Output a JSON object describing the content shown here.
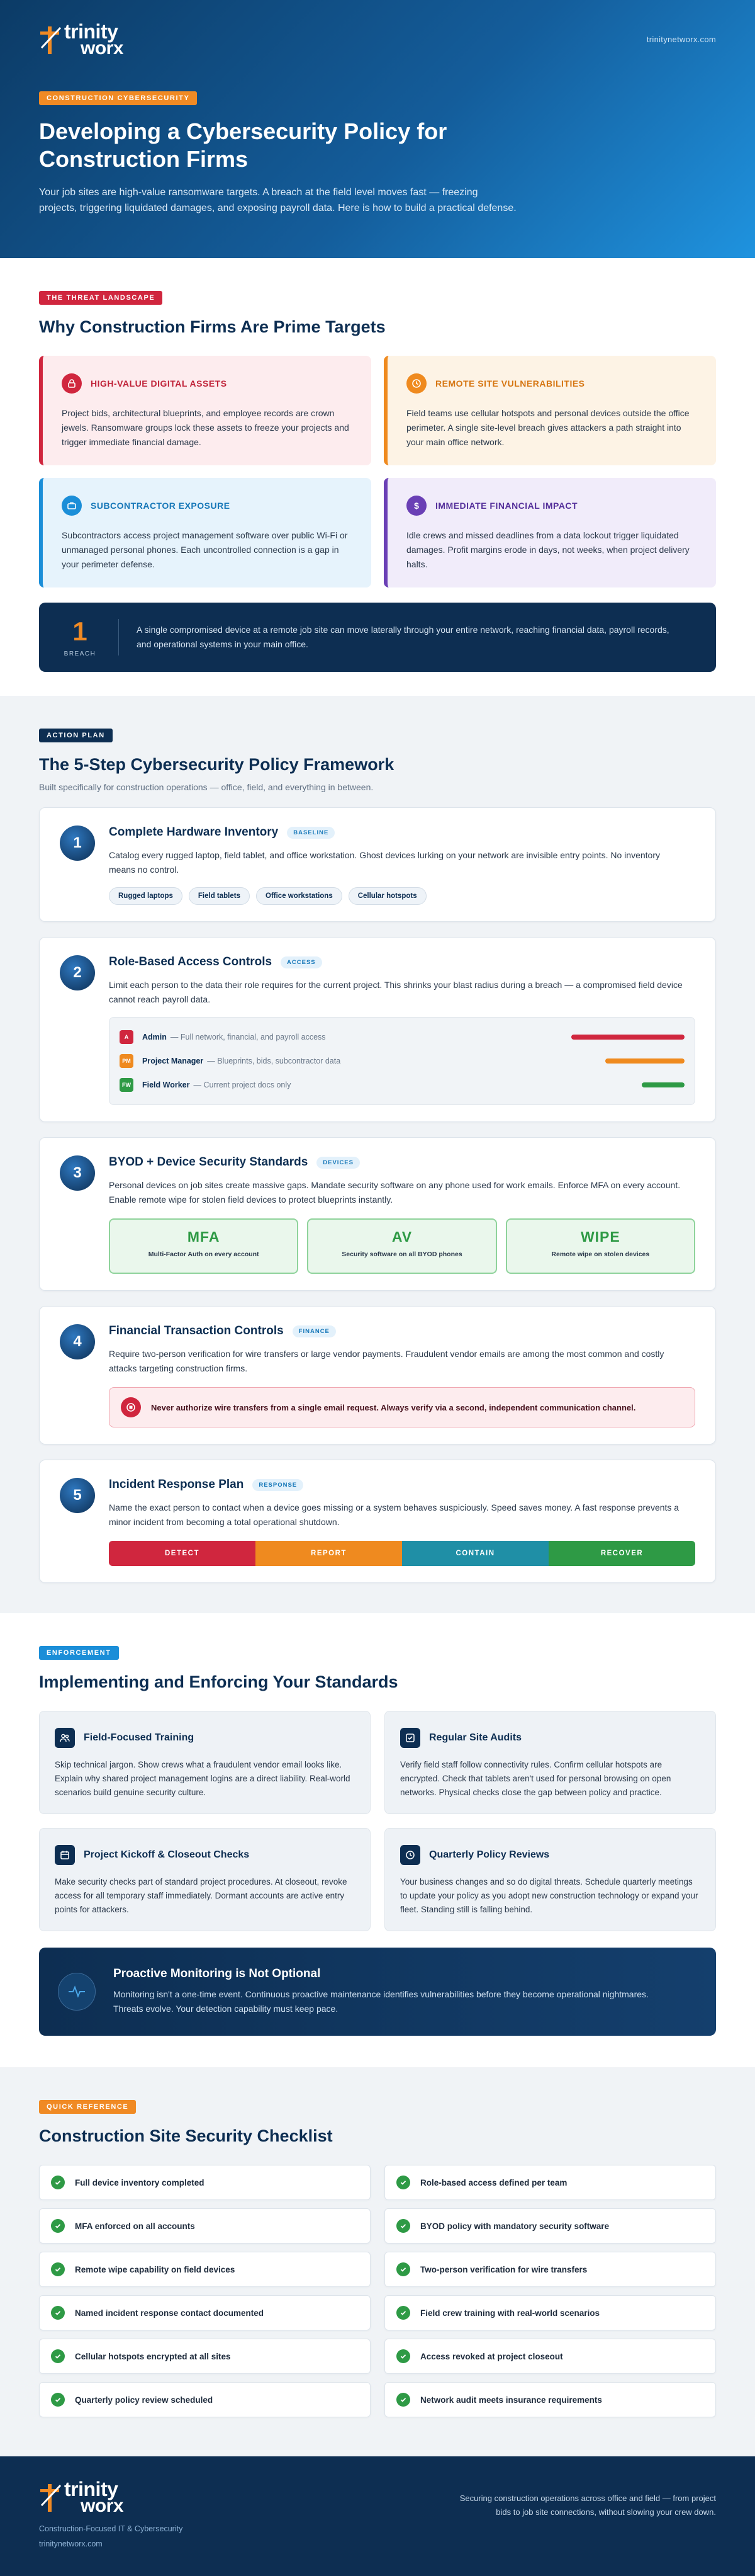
{
  "brand": {
    "logo_line1": "trinity",
    "logo_line2": "worx",
    "url": "trinitynetworx.com"
  },
  "hero": {
    "tag": "Construction Cybersecurity",
    "title": "Developing a Cybersecurity Policy for Construction Firms",
    "subtitle": "Your job sites are high-value ransomware targets. A breach at the field level moves fast — freezing projects, triggering liquidated damages, and exposing payroll data. Here is how to build a practical defense."
  },
  "threat": {
    "tag": "The Threat Landscape",
    "title": "Why Construction Firms Are Prime Targets",
    "cards": [
      {
        "icon": "lock-icon",
        "title": "High-Value Digital Assets",
        "text": "Project bids, architectural blueprints, and employee records are crown jewels. Ransomware groups lock these assets to freeze your projects and trigger immediate financial damage."
      },
      {
        "icon": "clock-icon",
        "title": "Remote Site Vulnerabilities",
        "text": "Field teams use cellular hotspots and personal devices outside the office perimeter. A single site-level breach gives attackers a path straight into your main office network."
      },
      {
        "icon": "briefcase-icon",
        "title": "Subcontractor Exposure",
        "text": "Subcontractors access project management software over public Wi-Fi or unmanaged personal phones. Each uncontrolled connection is a gap in your perimeter defense."
      },
      {
        "icon": "dollar-icon",
        "title": "Immediate Financial Impact",
        "text": "Idle crews and missed deadlines from a data lockout trigger liquidated damages. Profit margins erode in days, not weeks, when project delivery halts."
      }
    ],
    "callout": {
      "number": "1",
      "label": "BREACH",
      "text": "A single compromised device at a remote job site can move laterally through your entire network, reaching financial data, payroll records, and operational systems in your main office."
    }
  },
  "framework": {
    "tag": "Action Plan",
    "title": "The 5-Step Cybersecurity Policy Framework",
    "subtitle": "Built specifically for construction operations — office, field, and everything in between.",
    "steps": [
      {
        "num": "1",
        "title": "Complete Hardware Inventory",
        "badge": "Baseline",
        "text": "Catalog every rugged laptop, field tablet, and office workstation. Ghost devices lurking on your network are invisible entry points. No inventory means no control.",
        "pills": [
          "Rugged laptops",
          "Field tablets",
          "Office workstations",
          "Cellular hotspots"
        ]
      },
      {
        "num": "2",
        "title": "Role-Based Access Controls",
        "badge": "Access",
        "text": "Limit each person to the data their role requires for the current project. This shrinks your blast radius during a breach — a compromised field device cannot reach payroll data.",
        "roles": [
          {
            "abbr": "A",
            "name": "Admin",
            "desc": "— Full network, financial, and payroll access",
            "color": "#d0263e",
            "level": 1.0
          },
          {
            "abbr": "PM",
            "name": "Project Manager",
            "desc": "— Blueprints, bids, subcontractor data",
            "color": "#ef8a1f",
            "level": 0.7
          },
          {
            "abbr": "FW",
            "name": "Field Worker",
            "desc": "— Current project docs only",
            "color": "#2e9a45",
            "level": 0.38
          }
        ]
      },
      {
        "num": "3",
        "title": "BYOD + Device Security Standards",
        "badge": "Devices",
        "text": "Personal devices on job sites create massive gaps. Mandate security software on any phone used for work emails. Enforce MFA on every account. Enable remote wipe for stolen field devices to protect blueprints instantly.",
        "boxes": [
          {
            "big": "MFA",
            "small": "Multi-Factor Auth on every account"
          },
          {
            "big": "AV",
            "small": "Security software on all BYOD phones"
          },
          {
            "big": "WIPE",
            "small": "Remote wipe on stolen devices"
          }
        ]
      },
      {
        "num": "4",
        "title": "Financial Transaction Controls",
        "badge": "Finance",
        "text": "Require two-person verification for wire transfers or large vendor payments. Fraudulent vendor emails are among the most common and costly attacks targeting construction firms.",
        "warning": "Never authorize wire transfers from a single email request. Always verify via a second, independent communication channel."
      },
      {
        "num": "5",
        "title": "Incident Response Plan",
        "badge": "Response",
        "text": "Name the exact person to contact when a device goes missing or a system behaves suspiciously. Speed saves money. A fast response prevents a minor incident from becoming a total operational shutdown.",
        "flow": [
          {
            "label": "DETECT",
            "color": "#d0263e"
          },
          {
            "label": "REPORT",
            "color": "#ef8a1f"
          },
          {
            "label": "CONTAIN",
            "color": "#1f8fa6"
          },
          {
            "label": "RECOVER",
            "color": "#2e9a45"
          }
        ]
      }
    ]
  },
  "enforcement": {
    "tag": "Enforcement",
    "title": "Implementing and Enforcing Your Standards",
    "cards": [
      {
        "icon": "people-icon",
        "title": "Field-Focused Training",
        "text": "Skip technical jargon. Show crews what a fraudulent vendor email looks like. Explain why shared project management logins are a direct liability. Real-world scenarios build genuine security culture."
      },
      {
        "icon": "checkbox-icon",
        "title": "Regular Site Audits",
        "text": "Verify field staff follow connectivity rules. Confirm cellular hotspots are encrypted. Check that tablets aren't used for personal browsing on open networks. Physical checks close the gap between policy and practice."
      },
      {
        "icon": "calendar-icon",
        "title": "Project Kickoff & Closeout Checks",
        "text": "Make security checks part of standard project procedures. At closeout, revoke access for all temporary staff immediately. Dormant accounts are active entry points for attackers."
      },
      {
        "icon": "clock-icon",
        "title": "Quarterly Policy Reviews",
        "text": "Your business changes and so do digital threats. Schedule quarterly meetings to update your policy as you adopt new construction technology or expand your fleet. Standing still is falling behind."
      }
    ],
    "callout": {
      "icon": "pulse-icon",
      "title": "Proactive Monitoring is Not Optional",
      "text": "Monitoring isn't a one-time event. Continuous proactive maintenance identifies vulnerabilities before they become operational nightmares. Threats evolve. Your detection capability must keep pace."
    }
  },
  "checklist": {
    "tag": "Quick Reference",
    "title": "Construction Site Security Checklist",
    "items": [
      "Full device inventory completed",
      "Role-based access defined per team",
      "MFA enforced on all accounts",
      "BYOD policy with mandatory security software",
      "Remote wipe capability on field devices",
      "Two-person verification for wire transfers",
      "Named incident response contact documented",
      "Field crew training with real-world scenarios",
      "Cellular hotspots encrypted at all sites",
      "Access revoked at project closeout",
      "Quarterly policy review scheduled",
      "Network audit meets insurance requirements"
    ]
  },
  "footer": {
    "tagline": "Construction-Focused IT & Cybersecurity",
    "url": "trinitynetworx.com",
    "note": "Securing construction operations across office and field — from project bids to job site connections, without slowing your crew down."
  },
  "colors": {
    "navy": "#0d2e52",
    "orange": "#f08a24",
    "red": "#d0263e",
    "blue": "#1b8ed8",
    "green": "#2e9a45",
    "purple": "#6a3fb5"
  }
}
